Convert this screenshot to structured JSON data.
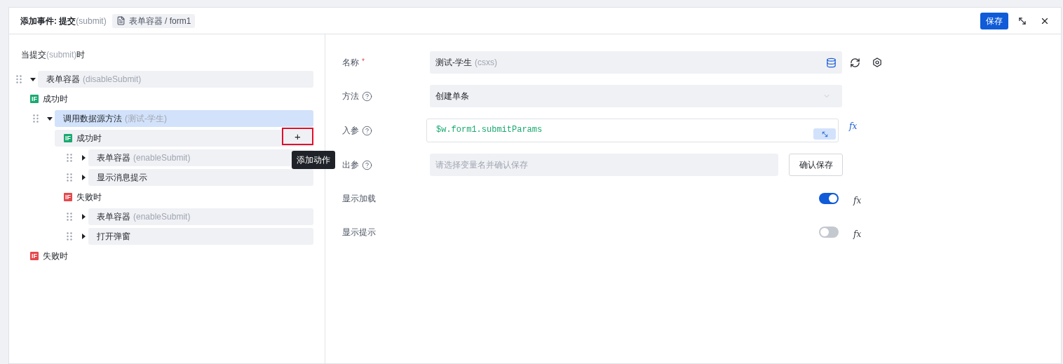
{
  "header": {
    "title": "添加事件: 提交",
    "title_event": "(submit)",
    "breadcrumb": "表单容器 / form1",
    "save": "保存"
  },
  "trigger": {
    "prefix": "当提交",
    "event": "(submit)",
    "suffix": "时"
  },
  "tree": [
    {
      "kind": "action",
      "label": "表单容器",
      "detail": "(disableSubmit)",
      "expanded": true,
      "selected": false,
      "children": [
        {
          "kind": "branch",
          "color": "#1aa971",
          "badge": "IF",
          "label": "成功时",
          "hovered": false,
          "children": [
            {
              "kind": "action",
              "label": "调用数据源方法",
              "detail": "(测试-学生)",
              "expanded": true,
              "selected": true,
              "children": [
                {
                  "kind": "branch",
                  "color": "#1aa971",
                  "badge": "IF",
                  "label": "成功时",
                  "hovered": true,
                  "add": "+",
                  "tooltip": "添加动作",
                  "children": [
                    {
                      "kind": "action",
                      "label": "表单容器",
                      "detail": "(enableSubmit)",
                      "expanded": false,
                      "selected": false
                    },
                    {
                      "kind": "action",
                      "label": "显示消息提示",
                      "expanded": false,
                      "selected": false
                    }
                  ]
                },
                {
                  "kind": "branch",
                  "color": "#e5484d",
                  "badge": "IF",
                  "label": "失败时",
                  "hovered": false,
                  "children": [
                    {
                      "kind": "action",
                      "label": "表单容器",
                      "detail": "(enableSubmit)",
                      "expanded": false,
                      "selected": false
                    },
                    {
                      "kind": "action",
                      "label": "打开弹窗",
                      "expanded": false,
                      "selected": false
                    }
                  ]
                }
              ]
            }
          ]
        },
        {
          "kind": "branch",
          "color": "#e5484d",
          "badge": "IF",
          "label": "失败时",
          "hovered": false
        }
      ]
    }
  ],
  "fields": [
    {
      "kind": "datasource",
      "label": "名称",
      "required_mark": "*",
      "value": "测试-学生",
      "hint": "(csxs)"
    },
    {
      "kind": "select",
      "label": "方法",
      "help": true,
      "value": "创建单条"
    },
    {
      "kind": "code",
      "label": "入参",
      "help": true,
      "value": "$w.form1.submitParams",
      "formula": "fx"
    },
    {
      "kind": "output",
      "label": "出参",
      "help": true,
      "placeholder": "请选择变量名并确认保存",
      "button": "确认保存"
    },
    {
      "kind": "switch",
      "label": "显示加载",
      "on": true,
      "formula": "fx"
    },
    {
      "kind": "switch",
      "label": "显示提示",
      "on": false,
      "formula": "fx"
    }
  ]
}
